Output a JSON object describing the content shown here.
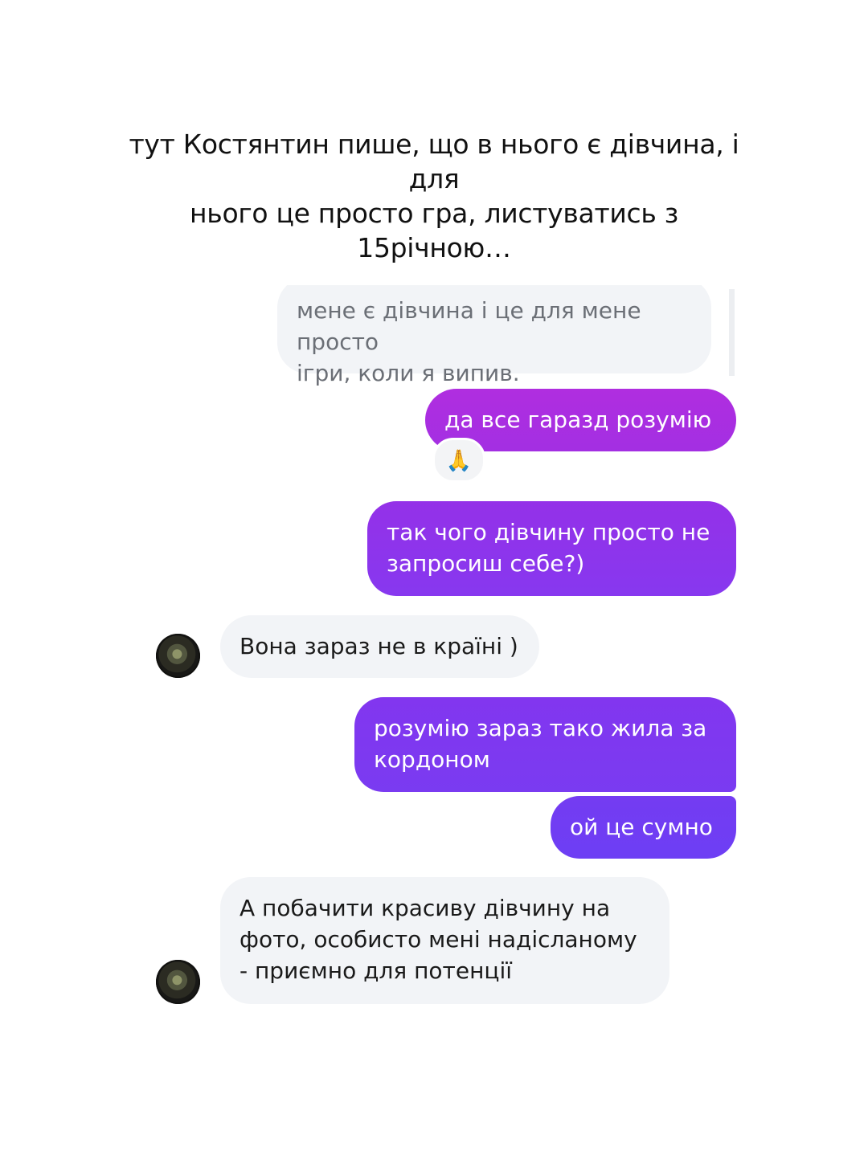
{
  "caption": {
    "line1": "тут Костянтин пише, що в нього є дівчина, і для",
    "line2": "нього це просто гра, листуватись з 15річною…"
  },
  "messages": [
    {
      "side": "in",
      "lines": [
        "мене є дівчина і це для мене просто",
        "ігри, коли я випив."
      ]
    },
    {
      "side": "out",
      "lines": [
        "да все гаразд розумію"
      ],
      "reaction": "🙏"
    },
    {
      "side": "out",
      "lines": [
        "так чого дівчину просто не",
        "запросиш себе?)"
      ]
    },
    {
      "side": "in",
      "lines": [
        "Вона зараз не в країні )"
      ]
    },
    {
      "side": "out",
      "lines": [
        "розумію зараз тако жила за",
        "кордоном"
      ]
    },
    {
      "side": "out",
      "lines": [
        "ой це сумно"
      ]
    },
    {
      "side": "in",
      "lines": [
        "А побачити красиву дівчину на",
        "фото, особисто мені надісланому",
        "- приємно для потенції"
      ]
    }
  ],
  "avatar_icon": "profile-photo",
  "colors": {
    "outgoing_gradient_top": "#b02ee0",
    "outgoing_gradient_bottom": "#6a3ff5",
    "incoming_bubble": "#f2f4f7"
  }
}
